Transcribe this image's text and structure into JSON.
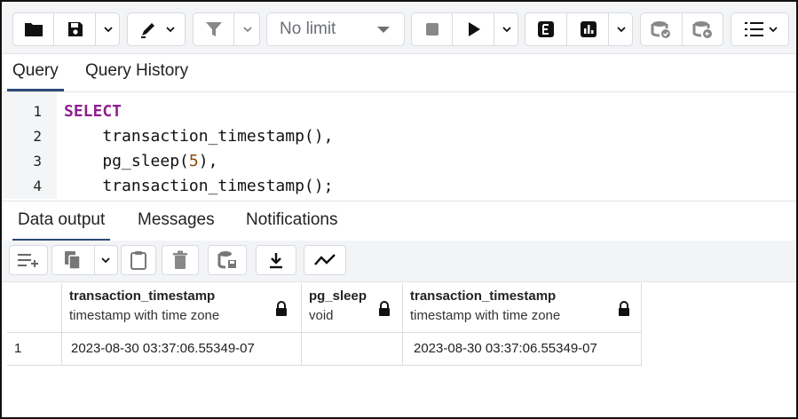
{
  "toolbar": {
    "buttons": [
      "folder-icon",
      "save-icon",
      "edit-icon",
      "filter-icon",
      "stop-icon",
      "play-icon",
      "explain-icon",
      "explain-analyze-icon",
      "commit-icon",
      "rollback-icon",
      "macros-icon"
    ],
    "limit_label": "No limit"
  },
  "query_tabs": [
    {
      "label": "Query",
      "active": true
    },
    {
      "label": "Query History",
      "active": false
    }
  ],
  "editor": {
    "line_numbers": [
      "1",
      "2",
      "3",
      "4"
    ],
    "lines": [
      {
        "keyword": "SELECT",
        "text": ""
      },
      {
        "keyword": "",
        "text": "    transaction_timestamp(),"
      },
      {
        "keyword": "",
        "text": "    pg_sleep(5),"
      },
      {
        "keyword": "",
        "text": "    transaction_timestamp();"
      }
    ]
  },
  "output_tabs": [
    {
      "label": "Data output",
      "active": true
    },
    {
      "label": "Messages",
      "active": false
    },
    {
      "label": "Notifications",
      "active": false
    }
  ],
  "grid": {
    "columns": [
      {
        "name": "transaction_timestamp",
        "type": "timestamp with time zone"
      },
      {
        "name": "pg_sleep",
        "type": "void"
      },
      {
        "name": "transaction_timestamp",
        "type": "timestamp with time zone"
      }
    ],
    "rows": [
      {
        "num": "1",
        "cells": [
          "2023-08-30 03:37:06.55349-07",
          "",
          "2023-08-30 03:37:06.55349-07"
        ]
      }
    ]
  },
  "colors": {
    "accent": "#2b4a78",
    "keyword": "#8f1f8f",
    "number": "#8a4a10"
  }
}
